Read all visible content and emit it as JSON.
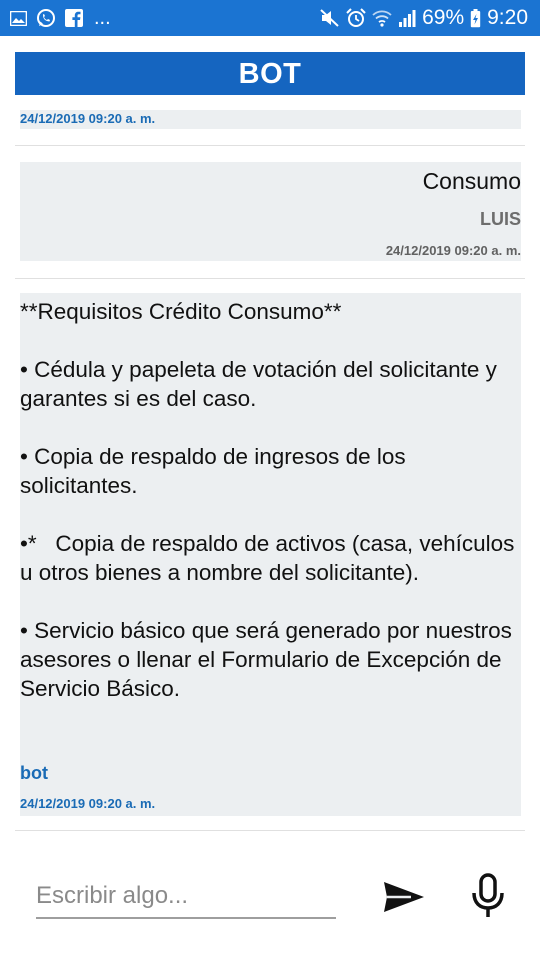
{
  "statusbar": {
    "left_icons": [
      "gallery-icon",
      "whatsapp-icon",
      "facebook-icon"
    ],
    "overflow": "...",
    "battery_percent": "69%",
    "time": "9:20",
    "right_icons": [
      "mute-icon",
      "alarm-icon",
      "wifi-icon",
      "signal-icon",
      "battery-icon"
    ]
  },
  "header": {
    "title": "BOT"
  },
  "messages": [
    {
      "role": "bot",
      "text": "",
      "timestamp": "24/12/2019 09:20 a. m."
    },
    {
      "role": "user",
      "text": "Consumo",
      "sender": "LUIS",
      "timestamp": "24/12/2019 09:20 a. m."
    },
    {
      "role": "bot",
      "text": "**Requisitos Crédito Consumo**\n\n• Cédula y papeleta de votación del solicitante y garantes si es del caso.\n\n• Copia de respaldo de ingresos de los solicitantes.\n\n•*   Copia de respaldo de activos (casa, vehículos u otros bienes a nombre del solicitante).\n\n• Servicio básico que será generado por nuestros asesores o llenar el Formulario de Excepción de Servicio Básico.",
      "sender": "bot",
      "timestamp": "24/12/2019 09:20 a. m."
    }
  ],
  "composer": {
    "placeholder": "Escribir algo...",
    "value": "",
    "send_icon": "send-icon",
    "mic_icon": "microphone-icon"
  },
  "colors": {
    "statusbar": "#1b74d2",
    "header": "#1565c0",
    "bubble": "#eceff1",
    "timestamp": "#1a6bb5",
    "sender_user": "#6d6d6d"
  }
}
